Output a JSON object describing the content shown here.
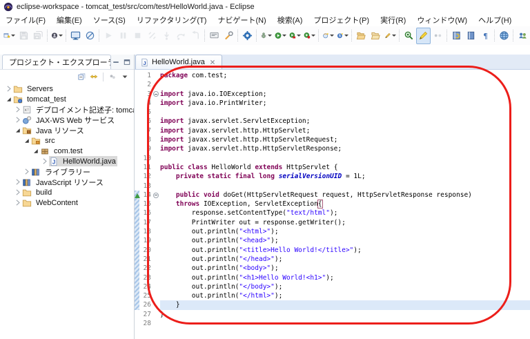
{
  "window": {
    "title": "eclipse-workspace - tomcat_test/src/com/test/HelloWorld.java - Eclipse"
  },
  "menubar": {
    "items": [
      "ファイル(F)",
      "編集(E)",
      "ソース(S)",
      "リファクタリング(T)",
      "ナビゲート(N)",
      "検索(A)",
      "プロジェクト(P)",
      "実行(R)",
      "ウィンドウ(W)",
      "ヘルプ(H)"
    ]
  },
  "toolbar": {
    "buttons": [
      {
        "name": "new-wizard",
        "dd": true
      },
      {
        "name": "save",
        "disabled": true
      },
      {
        "name": "save-all",
        "disabled": true
      },
      {
        "sep": true
      },
      {
        "name": "user-account",
        "dd": true
      },
      {
        "sep": true
      },
      {
        "name": "open-console"
      },
      {
        "name": "skip-breakpoints"
      },
      {
        "sep": true
      },
      {
        "name": "resume",
        "disabled": true
      },
      {
        "name": "suspend",
        "disabled": true
      },
      {
        "name": "terminate",
        "disabled": true
      },
      {
        "name": "disconnect",
        "disabled": true
      },
      {
        "name": "step-into",
        "disabled": true
      },
      {
        "name": "step-over",
        "disabled": true
      },
      {
        "name": "step-return",
        "disabled": true
      },
      {
        "sep": true
      },
      {
        "name": "pin-console"
      },
      {
        "name": "launch-config"
      },
      {
        "sep": true
      },
      {
        "name": "servers-view"
      },
      {
        "sep": true
      },
      {
        "name": "debug",
        "dd": true
      },
      {
        "name": "run",
        "dd": true
      },
      {
        "name": "coverage",
        "dd": true
      },
      {
        "name": "profile",
        "dd": true
      },
      {
        "sep": true
      },
      {
        "name": "new-web-service",
        "dd": true
      },
      {
        "name": "new-server",
        "dd": true
      },
      {
        "sep": true
      },
      {
        "name": "import-folder"
      },
      {
        "name": "export-folder"
      },
      {
        "name": "mark-pen",
        "dd": true
      },
      {
        "sep": true
      },
      {
        "name": "search-plugin"
      },
      {
        "name": "highlight-pen",
        "active": true
      },
      {
        "name": "format-dots"
      },
      {
        "sep": true
      },
      {
        "name": "build-doc"
      },
      {
        "name": "show-book"
      },
      {
        "name": "show-whitespace"
      },
      {
        "sep": true
      },
      {
        "name": "open-web-browser"
      },
      {
        "sep": true
      },
      {
        "name": "team-sync"
      },
      {
        "sep": true
      },
      {
        "name": "install-update"
      }
    ]
  },
  "explorer": {
    "title": "プロジェクト・エクスプローラー",
    "toolbar": [
      "collapse-all",
      "link-with-editor",
      "separator",
      "filter",
      "view-menu"
    ],
    "tree": [
      {
        "id": "servers",
        "label": "Servers",
        "depth": 1,
        "icon": "folder",
        "state": "collapsed"
      },
      {
        "id": "tomcat-test",
        "label": "tomcat_test",
        "depth": 1,
        "icon": "project",
        "state": "expanded"
      },
      {
        "id": "deployment-descriptor",
        "label": "デプロイメント記述子: tomcat_test",
        "depth": 2,
        "icon": "descriptor",
        "state": "collapsed"
      },
      {
        "id": "jax-ws-web-services",
        "label": "JAX-WS Web サービス",
        "depth": 2,
        "icon": "webservice",
        "state": "collapsed"
      },
      {
        "id": "java-resources",
        "label": "Java リソース",
        "depth": 2,
        "icon": "java-res",
        "state": "expanded"
      },
      {
        "id": "src",
        "label": "src",
        "depth": 3,
        "icon": "pkg-folder",
        "state": "expanded"
      },
      {
        "id": "com-test",
        "label": "com.test",
        "depth": 4,
        "icon": "package",
        "state": "expanded"
      },
      {
        "id": "helloworld-java",
        "label": "HelloWorld.java",
        "depth": 5,
        "icon": "jfile",
        "state": "collapsed",
        "selected": true
      },
      {
        "id": "libraries",
        "label": "ライブラリー",
        "depth": 3,
        "icon": "library",
        "state": "collapsed"
      },
      {
        "id": "javascript-resources",
        "label": "JavaScript リソース",
        "depth": 2,
        "icon": "library",
        "state": "collapsed"
      },
      {
        "id": "build",
        "label": "build",
        "depth": 2,
        "icon": "folder",
        "state": "collapsed"
      },
      {
        "id": "webcontent",
        "label": "WebContent",
        "depth": 2,
        "icon": "folder",
        "state": "collapsed"
      }
    ]
  },
  "editor": {
    "tab_title": "HelloWorld.java",
    "code": {
      "lines": [
        {
          "n": 1,
          "tokens": [
            [
              "kw",
              "package"
            ],
            [
              "pl",
              " com.test;"
            ]
          ]
        },
        {
          "n": 2,
          "tokens": []
        },
        {
          "n": 3,
          "fold": true,
          "tokens": [
            [
              "kw",
              "import"
            ],
            [
              "pl",
              " java.io.IOException;"
            ]
          ]
        },
        {
          "n": 4,
          "tokens": [
            [
              "kw",
              "import"
            ],
            [
              "pl",
              " java.io.PrintWriter;"
            ]
          ]
        },
        {
          "n": 5,
          "tokens": []
        },
        {
          "n": 6,
          "tokens": [
            [
              "kw",
              "import"
            ],
            [
              "pl",
              " javax.servlet.ServletException;"
            ]
          ]
        },
        {
          "n": 7,
          "tokens": [
            [
              "kw",
              "import"
            ],
            [
              "pl",
              " javax.servlet.http.HttpServlet;"
            ]
          ]
        },
        {
          "n": 8,
          "tokens": [
            [
              "kw",
              "import"
            ],
            [
              "pl",
              " javax.servlet.http.HttpServletRequest;"
            ]
          ]
        },
        {
          "n": 9,
          "tokens": [
            [
              "kw",
              "import"
            ],
            [
              "pl",
              " javax.servlet.http.HttpServletResponse;"
            ]
          ]
        },
        {
          "n": 10,
          "tokens": []
        },
        {
          "n": 11,
          "tokens": [
            [
              "kw",
              "public"
            ],
            [
              "pl",
              " "
            ],
            [
              "kw",
              "class"
            ],
            [
              "pl",
              " HelloWorld "
            ],
            [
              "kw",
              "extends"
            ],
            [
              "pl",
              " HttpServlet {"
            ]
          ]
        },
        {
          "n": 12,
          "tokens": [
            [
              "pl",
              "    "
            ],
            [
              "kw",
              "private"
            ],
            [
              "pl",
              " "
            ],
            [
              "kw",
              "static"
            ],
            [
              "pl",
              " "
            ],
            [
              "kw",
              "final"
            ],
            [
              "pl",
              " "
            ],
            [
              "kw",
              "long"
            ],
            [
              "pl",
              " "
            ],
            [
              "sf",
              "serialVersionUID"
            ],
            [
              "pl",
              " = 1L;"
            ]
          ]
        },
        {
          "n": 13,
          "tokens": []
        },
        {
          "n": 14,
          "fold": true,
          "qd": true,
          "marker": true,
          "tokens": [
            [
              "pl",
              "    "
            ],
            [
              "kw",
              "public"
            ],
            [
              "pl",
              " "
            ],
            [
              "kw",
              "void"
            ],
            [
              "pl",
              " doGet(HttpServletRequest request, HttpServletResponse response)"
            ]
          ]
        },
        {
          "n": 15,
          "qd": true,
          "tokens": [
            [
              "pl",
              "    "
            ],
            [
              "kw",
              "throws"
            ],
            [
              "pl",
              " IOException, ServletException"
            ],
            [
              "br",
              "{"
            ]
          ]
        },
        {
          "n": 16,
          "qd": true,
          "tokens": [
            [
              "pl",
              "        response.setContentType("
            ],
            [
              "str",
              "\"text/html\""
            ],
            [
              "pl",
              ");"
            ]
          ]
        },
        {
          "n": 17,
          "qd": true,
          "tokens": [
            [
              "pl",
              "        PrintWriter out = response.getWriter();"
            ]
          ]
        },
        {
          "n": 18,
          "qd": true,
          "tokens": [
            [
              "pl",
              "        out.println("
            ],
            [
              "str",
              "\"<html>\""
            ],
            [
              "pl",
              ");"
            ]
          ]
        },
        {
          "n": 19,
          "qd": true,
          "tokens": [
            [
              "pl",
              "        out.println("
            ],
            [
              "str",
              "\"<head>\""
            ],
            [
              "pl",
              ");"
            ]
          ]
        },
        {
          "n": 20,
          "qd": true,
          "tokens": [
            [
              "pl",
              "        out.println("
            ],
            [
              "str",
              "\"<title>Hello World!</title>\""
            ],
            [
              "pl",
              ");"
            ]
          ]
        },
        {
          "n": 21,
          "qd": true,
          "tokens": [
            [
              "pl",
              "        out.println("
            ],
            [
              "str",
              "\"</head>\""
            ],
            [
              "pl",
              ");"
            ]
          ]
        },
        {
          "n": 22,
          "qd": true,
          "tokens": [
            [
              "pl",
              "        out.println("
            ],
            [
              "str",
              "\"<body>\""
            ],
            [
              "pl",
              ");"
            ]
          ]
        },
        {
          "n": 23,
          "qd": true,
          "tokens": [
            [
              "pl",
              "        out.println("
            ],
            [
              "str",
              "\"<h1>Hello World!<h1>\""
            ],
            [
              "pl",
              ");"
            ]
          ]
        },
        {
          "n": 24,
          "qd": true,
          "tokens": [
            [
              "pl",
              "        out.println("
            ],
            [
              "str",
              "\"</body>\""
            ],
            [
              "pl",
              ");"
            ]
          ]
        },
        {
          "n": 25,
          "qd": true,
          "tokens": [
            [
              "pl",
              "        out.println("
            ],
            [
              "str",
              "\"</html>\""
            ],
            [
              "pl",
              ");"
            ]
          ]
        },
        {
          "n": 26,
          "qd": true,
          "current": true,
          "tokens": [
            [
              "pl",
              "    }"
            ]
          ]
        },
        {
          "n": 27,
          "tokens": [
            [
              "pl",
              "}"
            ]
          ]
        },
        {
          "n": 28,
          "tokens": []
        }
      ]
    }
  },
  "colors": {
    "keyword": "#7F0055",
    "string": "#2A00FF",
    "static_field": "#0000C0",
    "line_number": "#7d7d7d",
    "current_line_bg": "#dce9f9",
    "annotation_red": "#ec1e1a",
    "tree_selection_bg": "#d9d9d9",
    "tab_strip_bg": "#e2eaf6"
  }
}
